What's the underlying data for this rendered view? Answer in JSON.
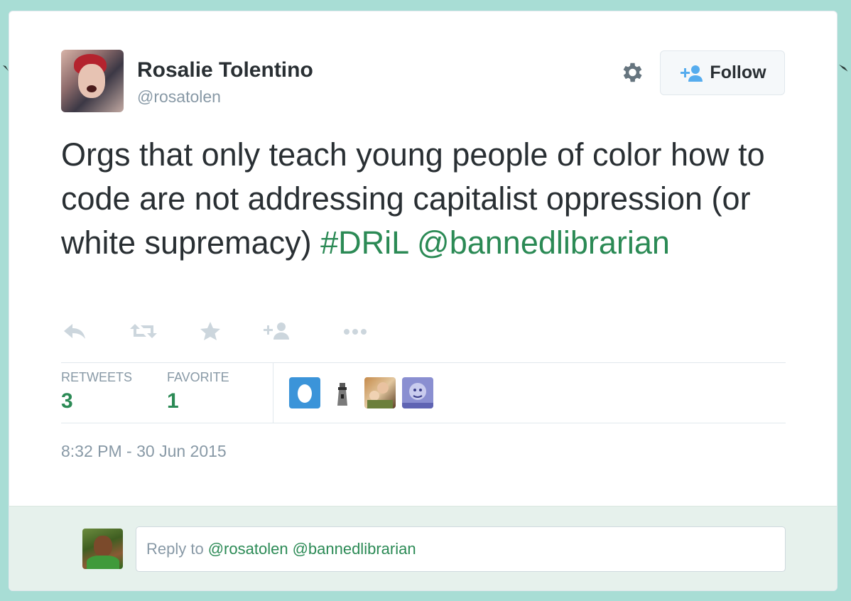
{
  "tweet": {
    "author_name": "Rosalie Tolentino",
    "author_handle": "@rosatolen",
    "text_before_links": "Orgs that only teach young people of color how to code are not addressing capitalist oppression (or white supremacy)",
    "hashtag": "#DRiL",
    "mention": "@bannedlibrarian",
    "timestamp": "8:32 PM - 30 Jun 2015"
  },
  "header": {
    "follow_label": "Follow"
  },
  "actions": [
    {
      "icon": "reply-icon"
    },
    {
      "icon": "retweet-icon"
    },
    {
      "icon": "favorite-star-icon"
    },
    {
      "icon": "follow-user-icon"
    },
    {
      "icon": "more-dots-icon"
    }
  ],
  "stats": {
    "retweets_label": "RETWEETS",
    "retweets_value": "3",
    "favorite_label": "FAVORITE",
    "favorite_value": "1"
  },
  "reply": {
    "prefix": "Reply to",
    "mentions": [
      "@rosatolen",
      "@bannedlibrarian"
    ]
  },
  "colors": {
    "background": "#a8ddd5",
    "link": "#2b8a55",
    "text": "#292f33",
    "muted": "#8899a6",
    "follow_icon": "#55acee"
  }
}
